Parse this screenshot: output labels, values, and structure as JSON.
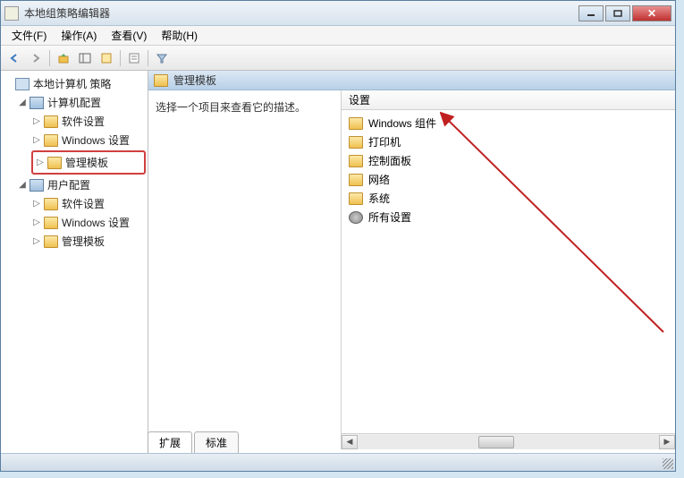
{
  "window": {
    "title": "本地组策略编辑器"
  },
  "menu": {
    "file": "文件(F)",
    "action": "操作(A)",
    "view": "查看(V)",
    "help": "帮助(H)"
  },
  "tree": {
    "root": "本地计算机 策略",
    "computer_config": "计算机配置",
    "cc_software": "软件设置",
    "cc_windows": "Windows 设置",
    "cc_admin": "管理模板",
    "user_config": "用户配置",
    "uc_software": "软件设置",
    "uc_windows": "Windows 设置",
    "uc_admin": "管理模板"
  },
  "breadcrumb": {
    "label": "管理模板"
  },
  "desc": {
    "text": "选择一个项目来查看它的描述。"
  },
  "list": {
    "header": "设置",
    "items": [
      {
        "icon": "folder",
        "label": "Windows 组件"
      },
      {
        "icon": "folder",
        "label": "打印机"
      },
      {
        "icon": "folder",
        "label": "控制面板"
      },
      {
        "icon": "folder",
        "label": "网络"
      },
      {
        "icon": "folder",
        "label": "系统"
      },
      {
        "icon": "gear",
        "label": "所有设置"
      }
    ]
  },
  "tabs": {
    "extended": "扩展",
    "standard": "标准"
  }
}
